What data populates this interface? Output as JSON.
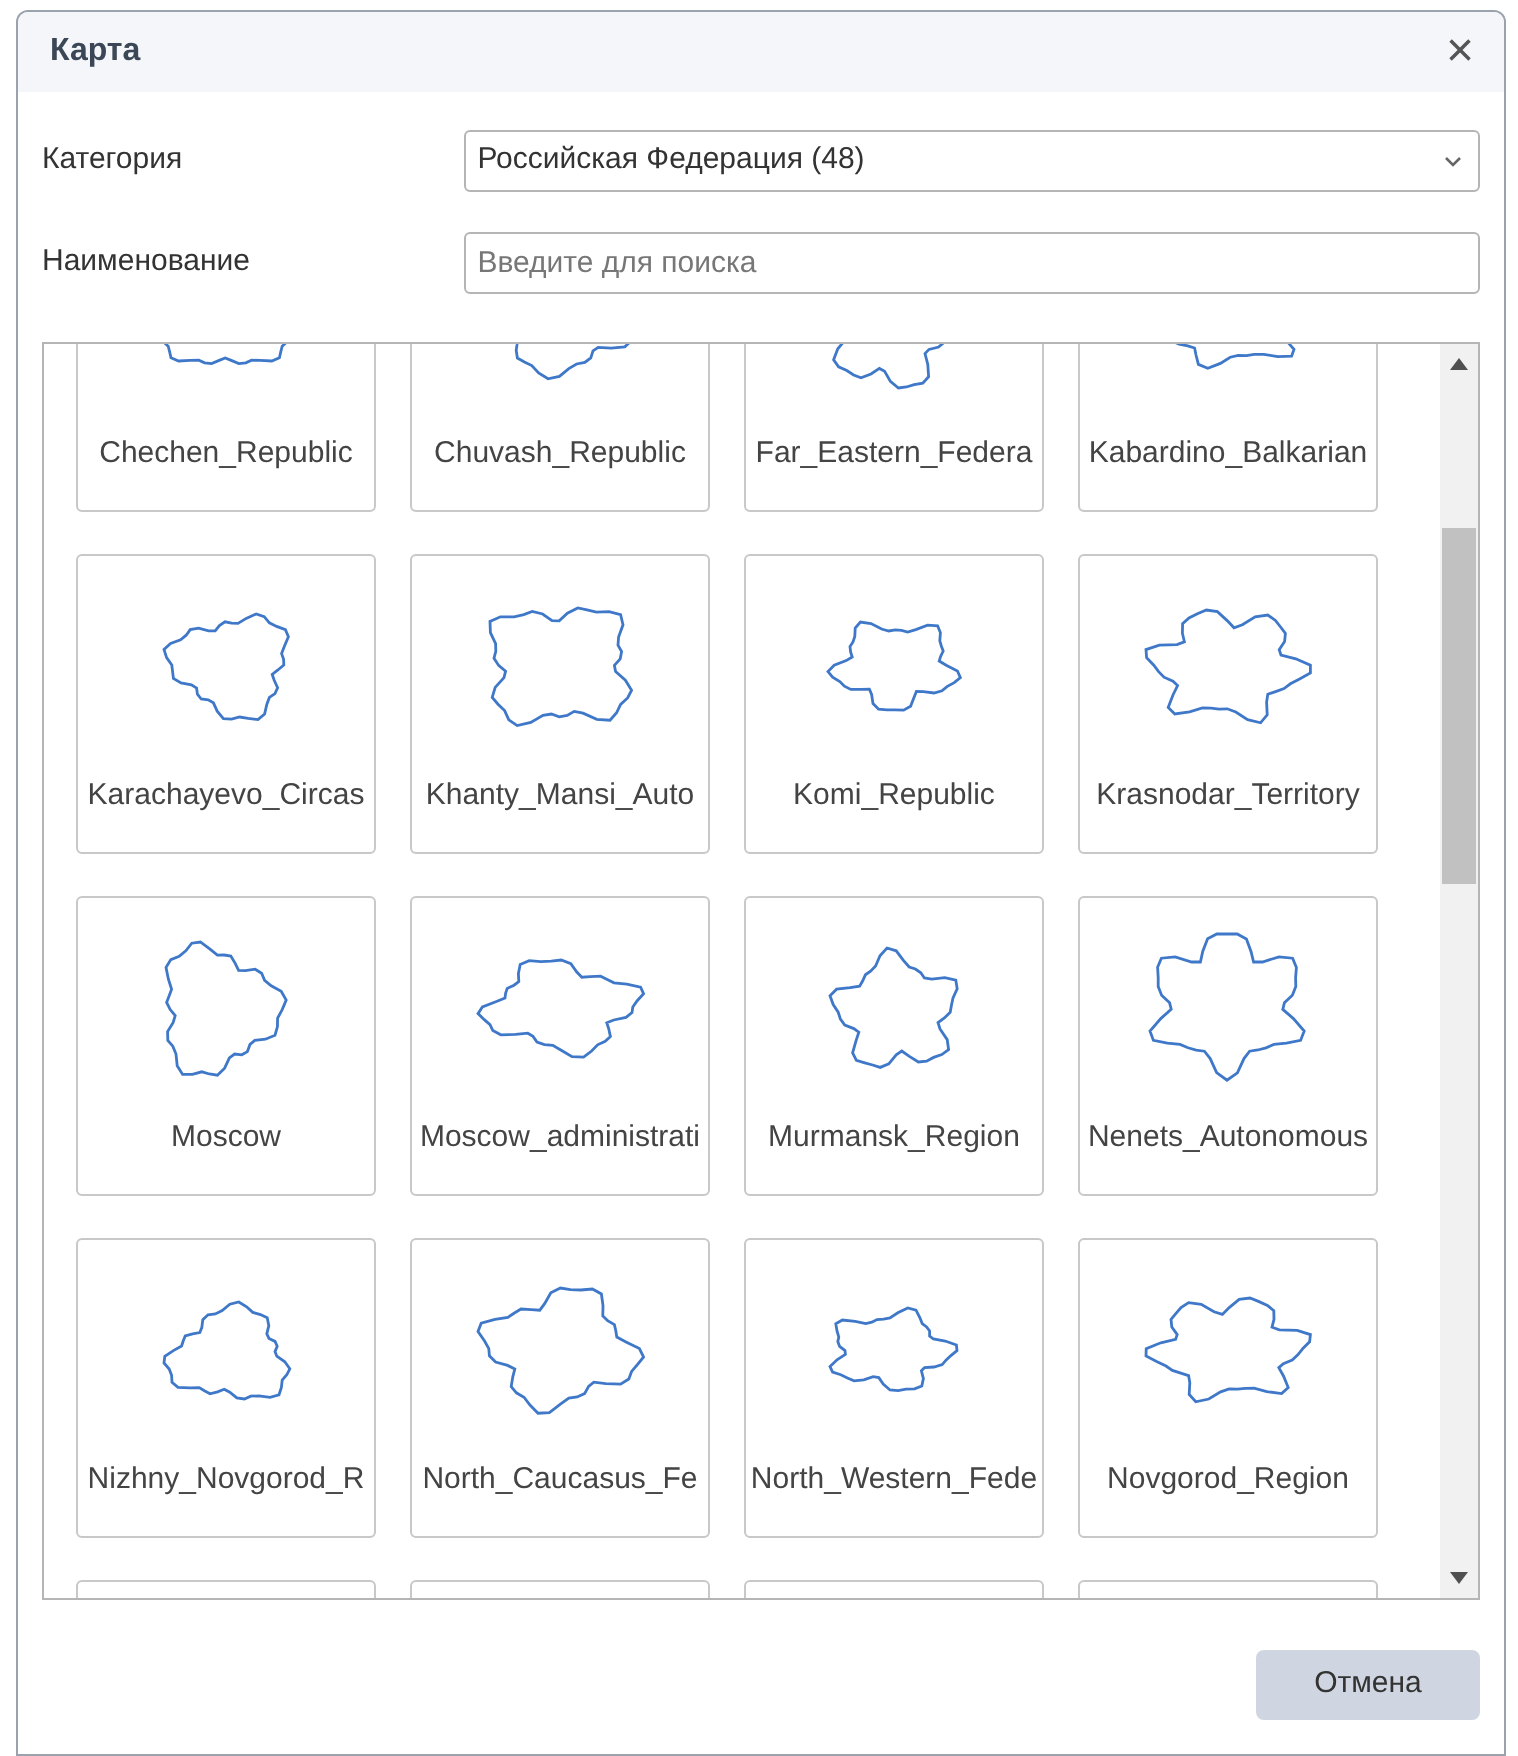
{
  "dialog": {
    "title": "Карта",
    "close": "×"
  },
  "form": [
    {
      "label": "Категория",
      "kind": "select",
      "value": "Российская Федерация (48)"
    },
    {
      "label": "Наименование",
      "kind": "text",
      "placeholder": "Введите для поиска"
    }
  ],
  "tiles": [
    {
      "kind": "tile",
      "name": "Chechen_Republic"
    },
    {
      "kind": "tile",
      "name": "Chuvash_Republic"
    },
    {
      "kind": "tile",
      "name": "Far_Eastern_Federa"
    },
    {
      "kind": "tile",
      "name": "Kabardino_Balkarian"
    },
    {
      "kind": "tile",
      "name": "Karachayevo_Circas"
    },
    {
      "kind": "tile",
      "name": "Khanty_Mansi_Auto"
    },
    {
      "kind": "tile",
      "name": "Komi_Republic"
    },
    {
      "kind": "tile",
      "name": "Krasnodar_Territory"
    },
    {
      "kind": "tile",
      "name": "Moscow"
    },
    {
      "kind": "tile",
      "name": "Moscow_administrati"
    },
    {
      "kind": "tile",
      "name": "Murmansk_Region"
    },
    {
      "kind": "tile",
      "name": "Nenets_Autonomous"
    },
    {
      "kind": "tile",
      "name": "Nizhny_Novgorod_R"
    },
    {
      "kind": "tile",
      "name": "North_Caucasus_Fe"
    },
    {
      "kind": "tile",
      "name": "North_Western_Fede"
    },
    {
      "kind": "tile",
      "name": "Novgorod_Region"
    },
    {
      "kind": "cut"
    },
    {
      "kind": "cut"
    },
    {
      "kind": "cut"
    },
    {
      "kind": "cut"
    }
  ],
  "buttons": [
    {
      "label": "Отмена"
    }
  ]
}
